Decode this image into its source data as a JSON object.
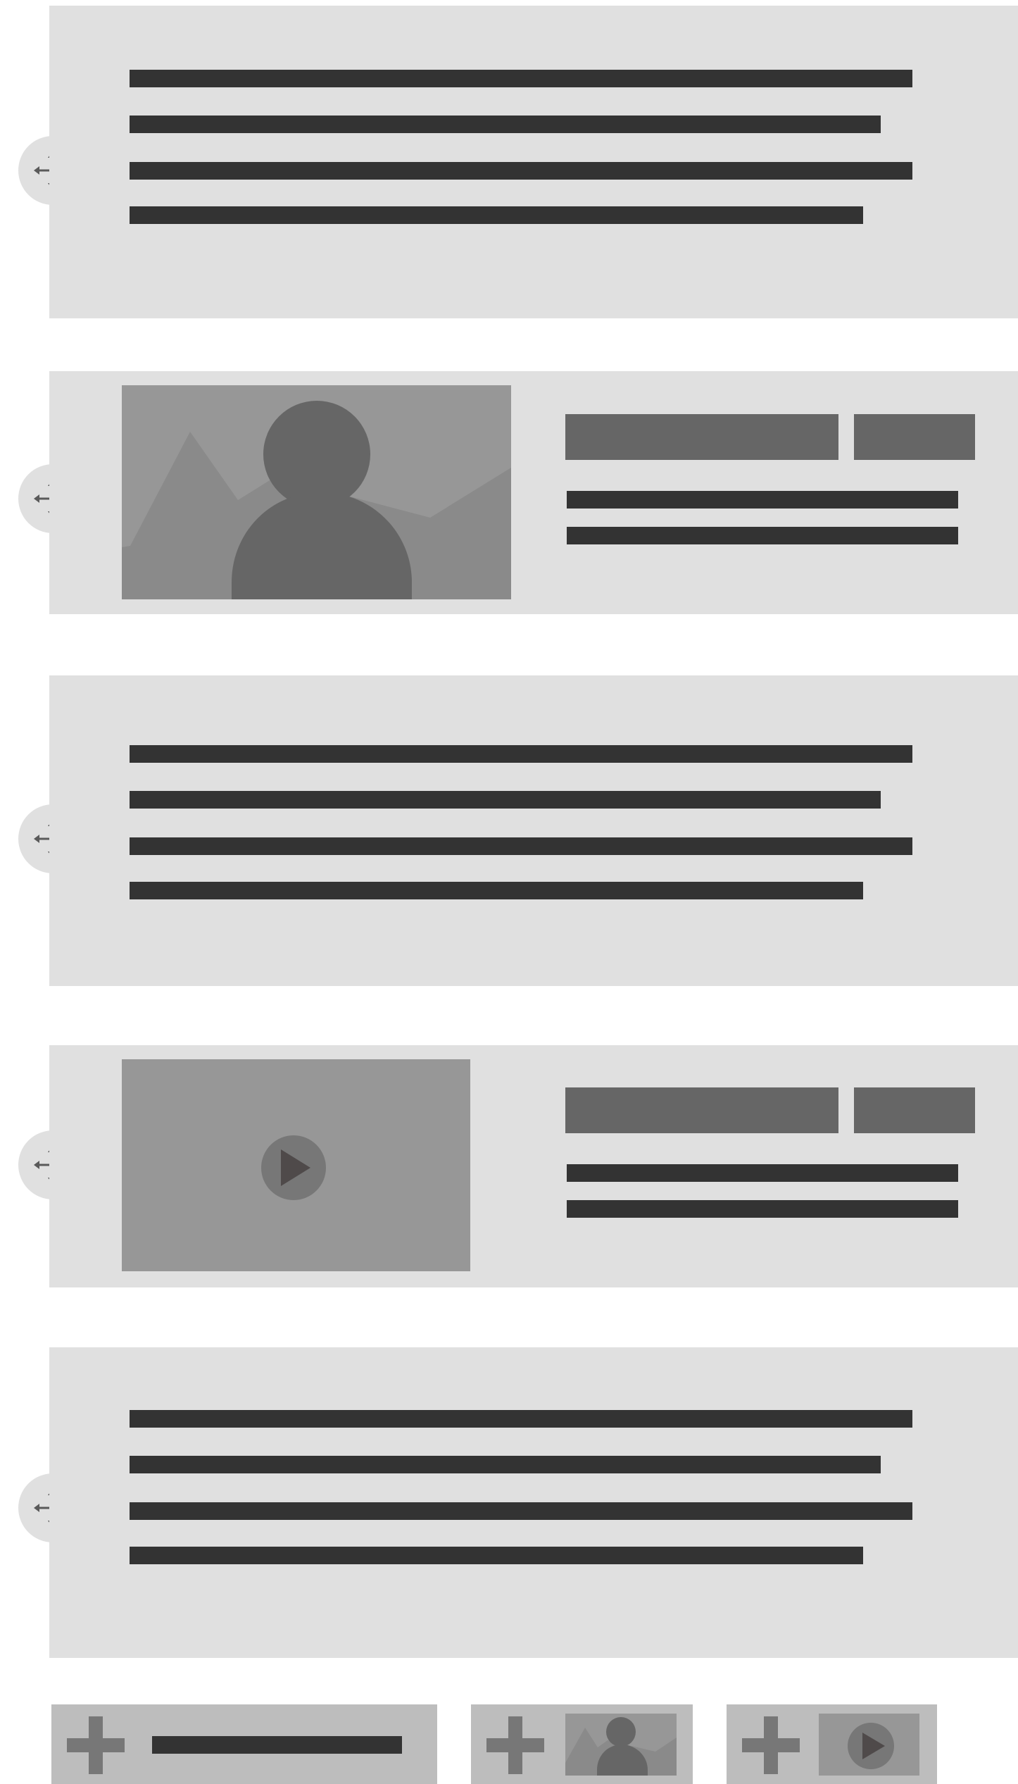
{
  "blocks": [
    {
      "type": "text",
      "name": "text-block-1"
    },
    {
      "type": "image",
      "name": "image-block"
    },
    {
      "type": "text",
      "name": "text-block-2"
    },
    {
      "type": "video",
      "name": "video-block"
    },
    {
      "type": "text",
      "name": "text-block-3"
    }
  ],
  "toolbar": {
    "buttons": [
      {
        "name": "add-text-button",
        "icon": "plus-icon"
      },
      {
        "name": "add-image-button",
        "icon": "plus-icon"
      },
      {
        "name": "add-video-button",
        "icon": "plus-icon"
      }
    ]
  },
  "icons": {
    "drag": "move-arrows-icon",
    "image": "person-photo-icon",
    "video": "play-icon"
  },
  "colors": {
    "block_background": "#e0e0e0",
    "text_line": "#333333",
    "tag": "#666666",
    "media": "#979797",
    "toolbar_button": "#bdbdbd"
  }
}
